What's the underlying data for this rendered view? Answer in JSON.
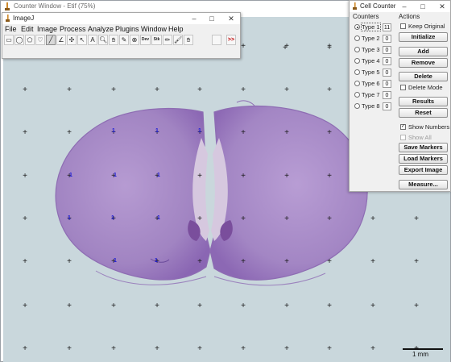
{
  "main_window": {
    "title": "Counter Window - Etif (75%)",
    "scale_bar_label": "1 mm"
  },
  "imagej": {
    "title": "ImageJ",
    "minimize": "–",
    "maximize": "□",
    "close": "✕",
    "menu": [
      "File",
      "Edit",
      "Image",
      "Process",
      "Analyze",
      "Plugins",
      "Window",
      "Help"
    ],
    "tools": [
      {
        "name": "rectangle-tool-icon",
        "glyph": "▭"
      },
      {
        "name": "oval-tool-icon",
        "glyph": "◯"
      },
      {
        "name": "polygon-tool-icon",
        "glyph": "⬠"
      },
      {
        "name": "freehand-tool-icon",
        "glyph": "♡"
      },
      {
        "name": "line-tool-icon",
        "glyph": "╱"
      },
      {
        "name": "angle-tool-icon",
        "glyph": "∠"
      },
      {
        "name": "point-tool-icon",
        "glyph": "✣"
      },
      {
        "name": "wand-tool-icon",
        "glyph": "↖"
      },
      {
        "name": "text-tool-icon",
        "glyph": "A"
      },
      {
        "name": "magnifier-tool-icon",
        "glyph": "🔍︎"
      },
      {
        "name": "hand-tool-icon",
        "glyph": "✋︎"
      },
      {
        "name": "dropper-tool-icon",
        "glyph": "✎"
      },
      {
        "name": "stop-tool-icon",
        "glyph": "⊗"
      },
      {
        "name": "developer-menu-icon",
        "glyph": "Dev"
      },
      {
        "name": "stacks-menu-icon",
        "glyph": "Stk"
      },
      {
        "name": "pencil-tool-icon",
        "glyph": "✏︎"
      },
      {
        "name": "brush-tool-icon",
        "glyph": "🖌︎"
      },
      {
        "name": "flood-fill-tool-icon",
        "glyph": "✋︎"
      },
      {
        "name": "empty-tool-slot-icon",
        "glyph": ""
      },
      {
        "name": "more-tools-icon",
        "glyph": ">>"
      }
    ]
  },
  "cell_counter": {
    "title": "Cell Counter",
    "minimize": "–",
    "maximize": "□",
    "close": "✕",
    "counters_heading": "Counters",
    "actions_heading": "Actions",
    "types": [
      {
        "label": "Type 1",
        "count": "11",
        "selected": true
      },
      {
        "label": "Type 2",
        "count": "0",
        "selected": false
      },
      {
        "label": "Type 3",
        "count": "0",
        "selected": false
      },
      {
        "label": "Type 4",
        "count": "0",
        "selected": false
      },
      {
        "label": "Type 5",
        "count": "0",
        "selected": false
      },
      {
        "label": "Type 6",
        "count": "0",
        "selected": false
      },
      {
        "label": "Type 7",
        "count": "0",
        "selected": false
      },
      {
        "label": "Type 8",
        "count": "0",
        "selected": false
      }
    ],
    "keep_original": {
      "label": "Keep Original",
      "checked": false
    },
    "initialize": "Initialize",
    "add": "Add",
    "remove": "Remove",
    "delete": "Delete",
    "delete_mode": {
      "label": "Delete Mode",
      "checked": false
    },
    "results": "Results",
    "reset": "Reset",
    "show_numbers": {
      "label": "Show Numbers",
      "checked": true
    },
    "show_all": {
      "label": "Show All",
      "checked": false,
      "disabled": true
    },
    "save_markers": "Save Markers",
    "load_markers": "Load Markers",
    "export_image": "Export Image",
    "measure": "Measure..."
  },
  "markers": [
    {
      "label": "1"
    },
    {
      "label": "1"
    },
    {
      "label": "1"
    },
    {
      "label": "1"
    },
    {
      "label": "1"
    },
    {
      "label": "1"
    },
    {
      "label": "1"
    },
    {
      "label": "1"
    },
    {
      "label": "1"
    },
    {
      "label": "1"
    },
    {
      "label": "1"
    }
  ],
  "colors": {
    "background": "#c9d7dc",
    "tissue": "#a184c2",
    "tissue_dark": "#7f5aa8",
    "marker": "#1d1dd8",
    "grid_cross": "#1a1a1a"
  }
}
